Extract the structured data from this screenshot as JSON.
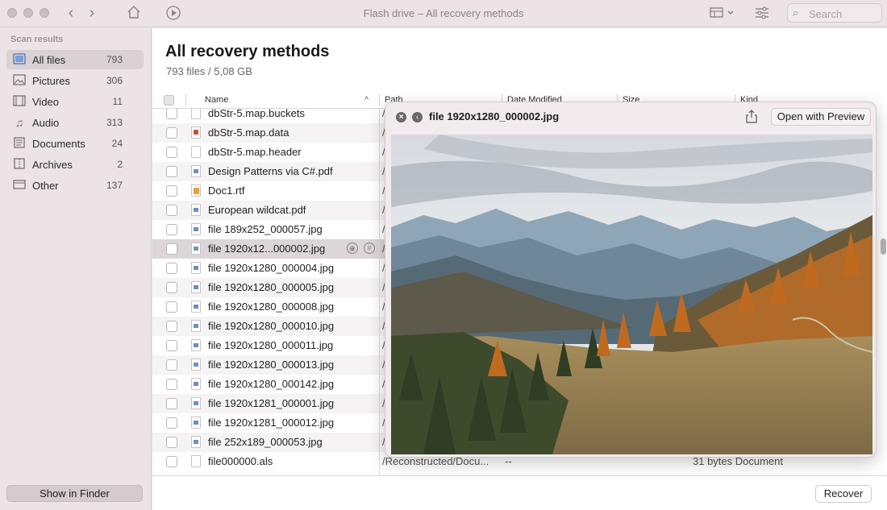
{
  "window": {
    "title": "Flash drive – All recovery methods"
  },
  "toolbar": {
    "search_placeholder": "Search"
  },
  "sidebar": {
    "heading": "Scan results",
    "items": [
      {
        "label": "All files",
        "count": "793",
        "icon": "all-files-icon"
      },
      {
        "label": "Pictures",
        "count": "306",
        "icon": "pictures-icon"
      },
      {
        "label": "Video",
        "count": "11",
        "icon": "video-icon"
      },
      {
        "label": "Audio",
        "count": "313",
        "icon": "audio-icon"
      },
      {
        "label": "Documents",
        "count": "24",
        "icon": "documents-icon"
      },
      {
        "label": "Archives",
        "count": "2",
        "icon": "archives-icon"
      },
      {
        "label": "Other",
        "count": "137",
        "icon": "other-icon"
      }
    ],
    "show_in_finder": "Show in Finder"
  },
  "main": {
    "title": "All recovery methods",
    "subtitle": "793 files / 5,08 GB",
    "columns": {
      "name": "Name",
      "path": "Path",
      "date": "Date Modified",
      "size": "Size",
      "kind": "Kind"
    },
    "rows": [
      {
        "name": "dbStr-5.map.buckets",
        "path": "/"
      },
      {
        "name": "dbStr-5.map.data",
        "path": "/"
      },
      {
        "name": "dbStr-5.map.header",
        "path": "/"
      },
      {
        "name": "Design Patterns via C#.pdf",
        "path": "/"
      },
      {
        "name": "Doc1.rtf",
        "path": "/"
      },
      {
        "name": "European wildcat.pdf",
        "path": "/"
      },
      {
        "name": "file 189x252_000057.jpg",
        "path": "/"
      },
      {
        "name": "file 1920x12...000002.jpg",
        "path": "/"
      },
      {
        "name": "file 1920x1280_000004.jpg",
        "path": "/"
      },
      {
        "name": "file 1920x1280_000005.jpg",
        "path": "/"
      },
      {
        "name": "file 1920x1280_000008.jpg",
        "path": "/"
      },
      {
        "name": "file 1920x1280_000010.jpg",
        "path": "/"
      },
      {
        "name": "file 1920x1280_000011.jpg",
        "path": "/"
      },
      {
        "name": "file 1920x1280_000013.jpg",
        "path": "/"
      },
      {
        "name": "file 1920x1280_000142.jpg",
        "path": "/"
      },
      {
        "name": "file 1920x1281_000001.jpg",
        "path": "/"
      },
      {
        "name": "file 1920x1281_000012.jpg",
        "path": "/"
      },
      {
        "name": "file 252x189_000053.jpg",
        "path": "/"
      },
      {
        "name": "file000000.als",
        "path": "/Reconstructed/Docu...",
        "date": "--",
        "size": "31 bytes  Document"
      }
    ],
    "recover": "Recover"
  },
  "preview": {
    "title": "file 1920x1280_000002.jpg",
    "open_with": "Open with Preview"
  },
  "colors": {
    "sidebar_bg": "#ebe3e6",
    "selection": "#d9d1d4",
    "accent": "#6f7a96"
  }
}
